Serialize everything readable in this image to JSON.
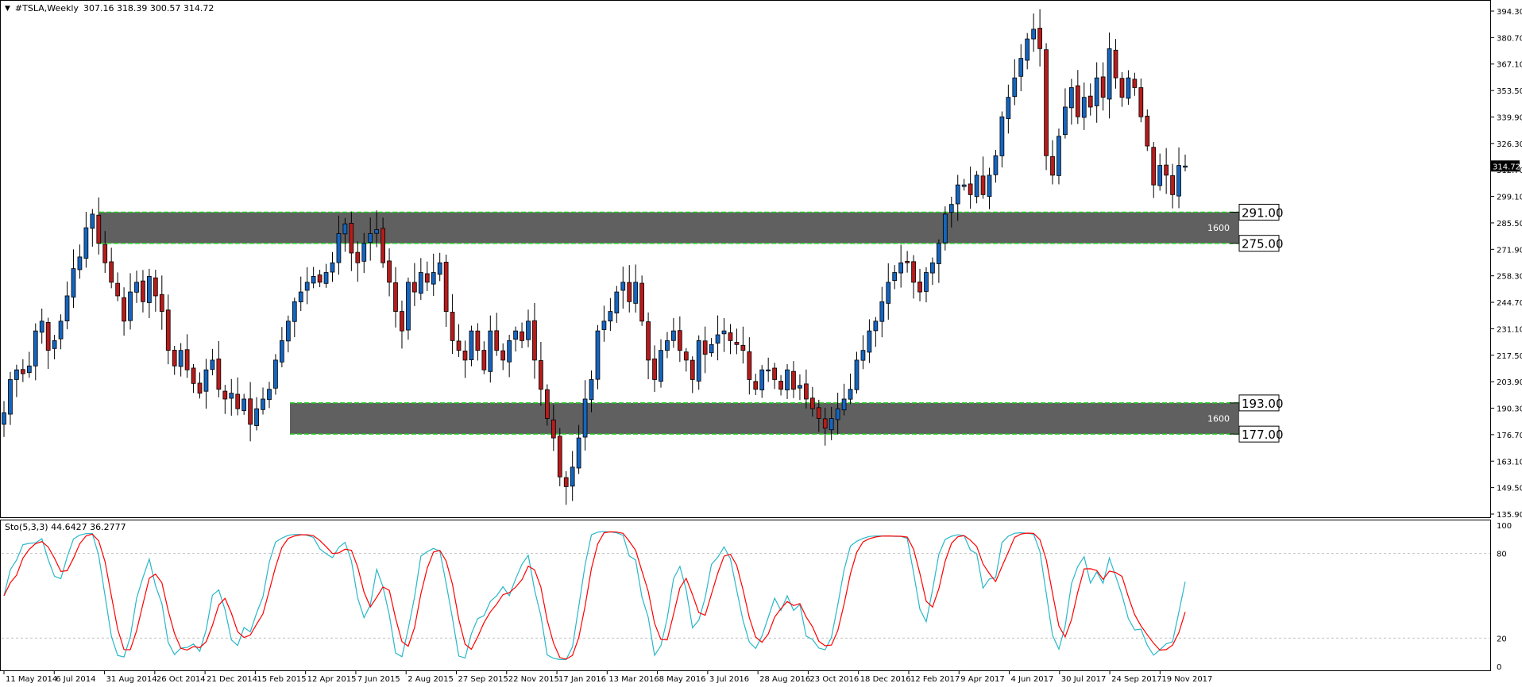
{
  "header": {
    "symbol": "#TSLA,Weekly",
    "ohlc": "307.16 318.39 300.57 314.72",
    "menu_arrow": "▼"
  },
  "indicator": {
    "label": "Sto(5,3,3) 44.6427 36.2777",
    "levels": {
      "top": "100",
      "upper": "80",
      "lower": "20",
      "bottom": "0"
    },
    "main_color": "#2ab7c8",
    "signal_color": "#ff0000"
  },
  "chart_data": {
    "type": "candlestick",
    "title": "#TSLA,Weekly",
    "ylim": [
      135.9,
      394.3
    ],
    "y_ticks": [
      "394.30",
      "380.70",
      "367.10",
      "353.50",
      "339.90",
      "326.30",
      "312.70",
      "299.10",
      "285.50",
      "271.90",
      "258.30",
      "244.70",
      "231.10",
      "217.50",
      "203.90",
      "190.30",
      "176.70",
      "163.10",
      "149.50",
      "135.90"
    ],
    "current_price": "314.72",
    "x_labels": [
      "11 May 2014",
      "6 Jul 2014",
      "31 Aug 2014",
      "26 Oct 2014",
      "21 Dec 2014",
      "15 Feb 2015",
      "12 Apr 2015",
      "7 Jun 2015",
      "2 Aug 2015",
      "27 Sep 2015",
      "22 Nov 2015",
      "17 Jan 2016",
      "13 Mar 2016",
      "8 May 2016",
      "3 Jul 2016",
      "28 Aug 2016",
      "23 Oct 2016",
      "18 Dec 2016",
      "12 Feb 2017",
      "9 Apr 2017",
      "4 Jun 2017",
      "30 Jul 2017",
      "24 Sep 2017",
      "19 Nov 2017"
    ],
    "zones": [
      {
        "top": 291.0,
        "bottom": 275.0,
        "top_label": "291.00",
        "bottom_label": "275.00",
        "inner_label": "1600"
      },
      {
        "top": 193.0,
        "bottom": 177.0,
        "top_label": "193.00",
        "bottom_label": "177.00",
        "inner_label": "1600"
      }
    ],
    "close": [
      188,
      205,
      210,
      208,
      212,
      230,
      235,
      220,
      225,
      235,
      248,
      262,
      268,
      283,
      290,
      275,
      265,
      255,
      248,
      235,
      250,
      255,
      245,
      258,
      248,
      240,
      220,
      212,
      220,
      210,
      203,
      198,
      210,
      215,
      200,
      195,
      198,
      190,
      195,
      182,
      190,
      195,
      200,
      215,
      225,
      235,
      245,
      250,
      255,
      258,
      255,
      260,
      265,
      280,
      285,
      270,
      265,
      275,
      280,
      282,
      265,
      255,
      240,
      230,
      255,
      250,
      260,
      255,
      260,
      265,
      240,
      225,
      220,
      215,
      230,
      220,
      210,
      230,
      220,
      215,
      225,
      230,
      225,
      235,
      215,
      200,
      185,
      175,
      155,
      150,
      160,
      175,
      195,
      205,
      230,
      235,
      240,
      250,
      255,
      245,
      255,
      235,
      215,
      205,
      220,
      225,
      230,
      220,
      215,
      205,
      225,
      218,
      223,
      228,
      230,
      225,
      223,
      220,
      205,
      200,
      210,
      210,
      205,
      200,
      210,
      200,
      202,
      195,
      190,
      185,
      180,
      185,
      190,
      195,
      200,
      215,
      220,
      230,
      235,
      245,
      255,
      260,
      265,
      265,
      255,
      250,
      260,
      265,
      275,
      290,
      295,
      305,
      305,
      300,
      310,
      300,
      310,
      320,
      340,
      350,
      360,
      370,
      380,
      385,
      375,
      320,
      310,
      330,
      345,
      355,
      340,
      350,
      345,
      360,
      350,
      375,
      360,
      350,
      360,
      355,
      340,
      325,
      305,
      315,
      310,
      300,
      315,
      314.72
    ]
  }
}
